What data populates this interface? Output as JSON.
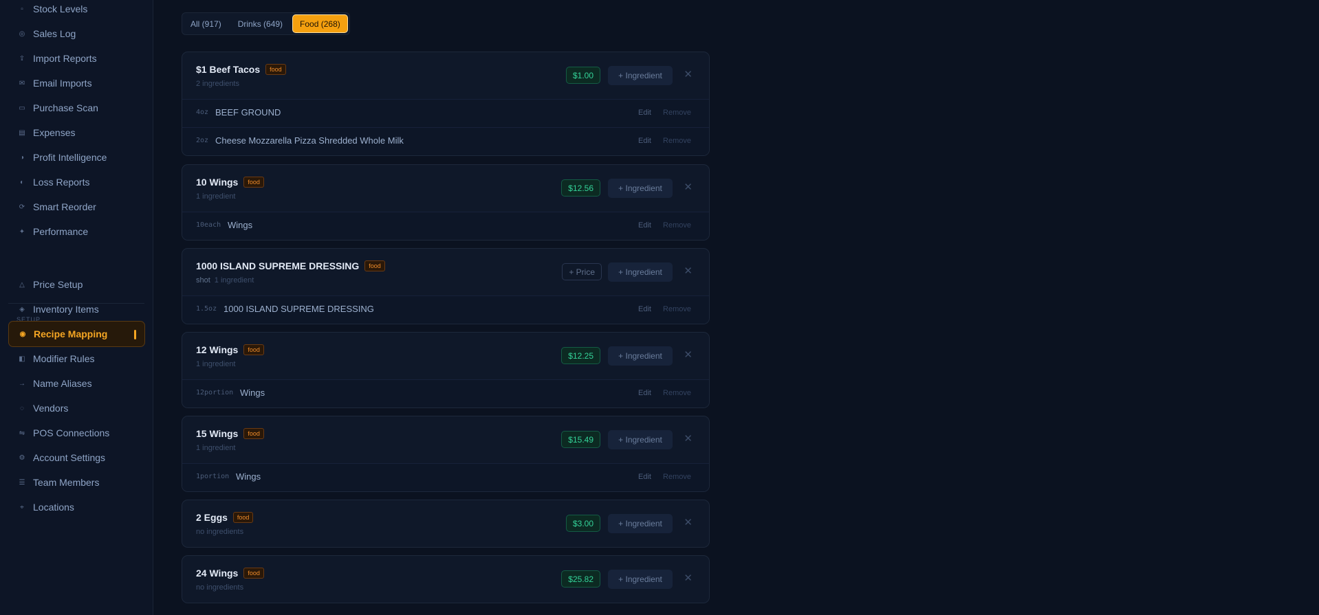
{
  "sidebar": {
    "section_label": "SETUP",
    "items": [
      {
        "label": "Stock Levels",
        "icon": "box-icon",
        "glyph": "▫"
      },
      {
        "label": "Sales Log",
        "icon": "receipt-icon",
        "glyph": "◎"
      },
      {
        "label": "Import Reports",
        "icon": "upload-icon",
        "glyph": "⇪"
      },
      {
        "label": "Email Imports",
        "icon": "mail-icon",
        "glyph": "✉"
      },
      {
        "label": "Purchase Scan",
        "icon": "scan-icon",
        "glyph": "▭"
      },
      {
        "label": "Expenses",
        "icon": "document-icon",
        "glyph": "▤"
      },
      {
        "label": "Profit Intelligence",
        "icon": "chart-icon",
        "glyph": "◑"
      },
      {
        "label": "Loss Reports",
        "icon": "loss-icon",
        "glyph": "◐"
      },
      {
        "label": "Smart Reorder",
        "icon": "refresh-icon",
        "glyph": "⟳"
      },
      {
        "label": "Performance",
        "icon": "spark-icon",
        "glyph": "✦"
      },
      {
        "label": "Price Setup",
        "icon": "triangle-icon",
        "glyph": "△"
      },
      {
        "label": "Inventory Items",
        "icon": "diamond-icon",
        "glyph": "◈"
      },
      {
        "label": "Recipe Mapping",
        "icon": "target-icon",
        "glyph": "◉"
      },
      {
        "label": "Modifier Rules",
        "icon": "half-square-icon",
        "glyph": "◧"
      },
      {
        "label": "Name Aliases",
        "icon": "arrow-right-icon",
        "glyph": "→"
      },
      {
        "label": "Vendors",
        "icon": "vendor-icon",
        "glyph": "◌"
      },
      {
        "label": "POS Connections",
        "icon": "link-icon",
        "glyph": "⇋"
      },
      {
        "label": "Account Settings",
        "icon": "gear-icon",
        "glyph": "⚙"
      },
      {
        "label": "Team Members",
        "icon": "team-icon",
        "glyph": "☰"
      },
      {
        "label": "Locations",
        "icon": "location-icon",
        "glyph": "⌖"
      }
    ]
  },
  "filters": [
    "All (917)",
    "Drinks (649)",
    "Food (268)"
  ],
  "actions": {
    "add_ingredient": "+ Ingredient",
    "add_price": "+ Price",
    "edit": "Edit",
    "remove": "Remove",
    "close": "✕"
  },
  "recipes": [
    {
      "name": "$1 Beef Tacos",
      "tag": "food",
      "unit": "",
      "count": "2 ingredients",
      "price": "$1.00",
      "ingredients": [
        {
          "qty": "4oz",
          "name": "BEEF GROUND"
        },
        {
          "qty": "2oz",
          "name": "Cheese Mozzarella Pizza Shredded Whole Milk"
        }
      ]
    },
    {
      "name": "10 Wings",
      "tag": "food",
      "unit": "",
      "count": "1 ingredient",
      "price": "$12.56",
      "ingredients": [
        {
          "qty": "10each",
          "name": "Wings"
        }
      ]
    },
    {
      "name": "1000 ISLAND SUPREME DRESSING",
      "tag": "food",
      "unit": "shot",
      "count": "1 ingredient",
      "price": "",
      "ingredients": [
        {
          "qty": "1.5oz",
          "name": "1000 ISLAND SUPREME DRESSING"
        }
      ]
    },
    {
      "name": "12 Wings",
      "tag": "food",
      "unit": "",
      "count": "1 ingredient",
      "price": "$12.25",
      "ingredients": [
        {
          "qty": "12portion",
          "name": "Wings"
        }
      ]
    },
    {
      "name": "15 Wings",
      "tag": "food",
      "unit": "",
      "count": "1 ingredient",
      "price": "$15.49",
      "ingredients": [
        {
          "qty": "1portion",
          "name": "Wings"
        }
      ]
    },
    {
      "name": "2 Eggs",
      "tag": "food",
      "unit": "",
      "count": "no ingredients",
      "price": "$3.00",
      "ingredients": []
    },
    {
      "name": "24 Wings",
      "tag": "food",
      "unit": "",
      "count": "no ingredients",
      "price": "$25.82",
      "ingredients": []
    }
  ]
}
